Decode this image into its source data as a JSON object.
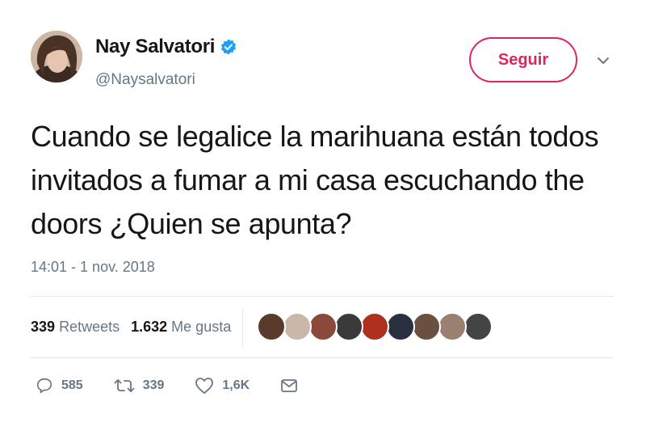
{
  "author": {
    "name": "Nay Salvatori",
    "handle": "@Naysalvatori",
    "verified_icon": "verified-badge-icon",
    "avatar_icon": "profile-photo"
  },
  "follow_button": {
    "label": "Seguir"
  },
  "more_menu": {
    "icon": "chevron-down-icon"
  },
  "tweet": {
    "text": "Cuando se legalice la marihuana están todos invitados a fumar a mi casa escuchando the doors ¿Quien se apunta?",
    "timestamp": "14:01 - 1 nov. 2018"
  },
  "stats": {
    "retweets_count": "339",
    "retweets_label": "Retweets",
    "likes_count": "1.632",
    "likes_label": "Me gusta",
    "likers_count": 9
  },
  "actions": {
    "reply_count": "585",
    "retweet_count": "339",
    "like_count": "1,6K",
    "reply_icon": "reply-icon",
    "retweet_icon": "retweet-icon",
    "like_icon": "heart-icon",
    "dm_icon": "envelope-icon"
  },
  "colors": {
    "accent": "#e0245e",
    "verified": "#1da1f2",
    "muted_text": "#657786",
    "divider": "#e1e8ed",
    "liker_avatars": [
      "#5a3a2a",
      "#c9b7a7",
      "#8a4a3a",
      "#3a3a3a",
      "#b03020",
      "#2a3040",
      "#6a5040",
      "#9a8070",
      "#444444"
    ]
  }
}
